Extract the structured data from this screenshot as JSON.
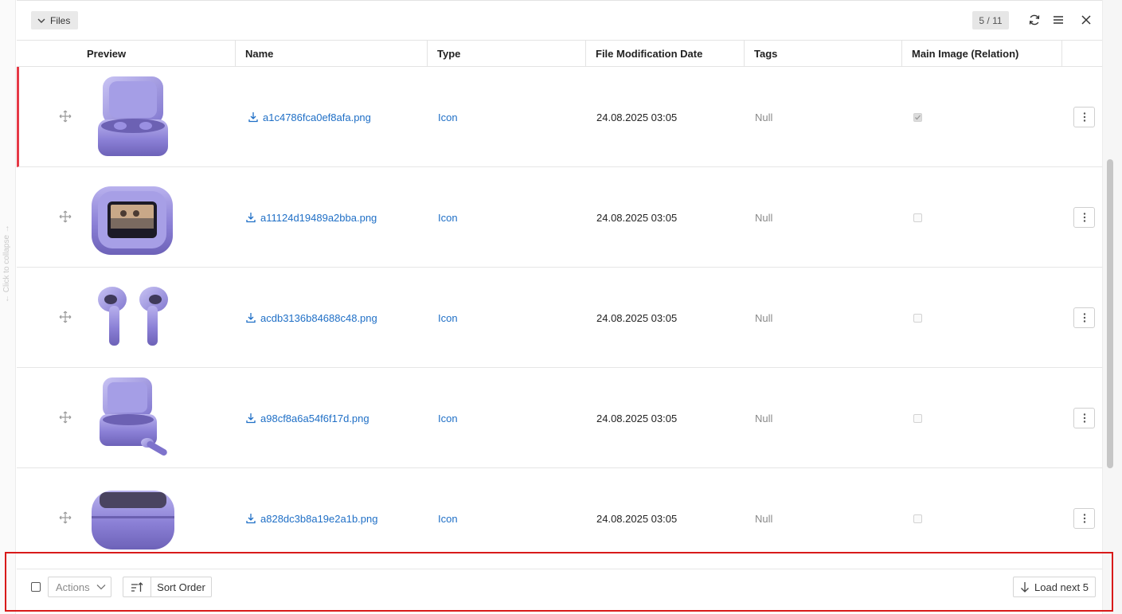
{
  "toolbar": {
    "files_label": "Files",
    "pager": "5 / 11",
    "icons": [
      "refresh-icon",
      "menu-icon",
      "close-icon"
    ]
  },
  "sidebar": {
    "collapse_hint": "← Click to collapse →"
  },
  "columns": [
    "Preview",
    "Name",
    "Type",
    "File Modification Date",
    "Tags",
    "Main Image (Relation)"
  ],
  "rows": [
    {
      "name": "a1c4786fca0ef8afa.png",
      "type": "Icon",
      "date": "24.08.2025 03:05",
      "tags": "Null",
      "main_image": true,
      "preview": "earbuds-case-open-icon",
      "selected": true
    },
    {
      "name": "a11124d19489a2bba.png",
      "type": "Icon",
      "date": "24.08.2025 03:05",
      "tags": "Null",
      "main_image": false,
      "preview": "case-screen-icon",
      "selected": false
    },
    {
      "name": "acdb3136b84688c48.png",
      "type": "Icon",
      "date": "24.08.2025 03:05",
      "tags": "Null",
      "main_image": false,
      "preview": "earbuds-pair-icon",
      "selected": false
    },
    {
      "name": "a98cf8a6a54f6f17d.png",
      "type": "Icon",
      "date": "24.08.2025 03:05",
      "tags": "Null",
      "main_image": false,
      "preview": "case-with-bud-icon",
      "selected": false
    },
    {
      "name": "a828dc3b8a19e2a1b.png",
      "type": "Icon",
      "date": "24.08.2025 03:05",
      "tags": "Null",
      "main_image": false,
      "preview": "closed-case-icon",
      "selected": false
    }
  ],
  "footer": {
    "actions_label": "Actions",
    "sort_label": "Sort Order",
    "load_next_label": "Load next 5"
  },
  "colors": {
    "link": "#1f6fc6",
    "selected_marker": "#e53946",
    "footer_outline": "#d81a1a",
    "product_purple": "#8c82d6"
  }
}
